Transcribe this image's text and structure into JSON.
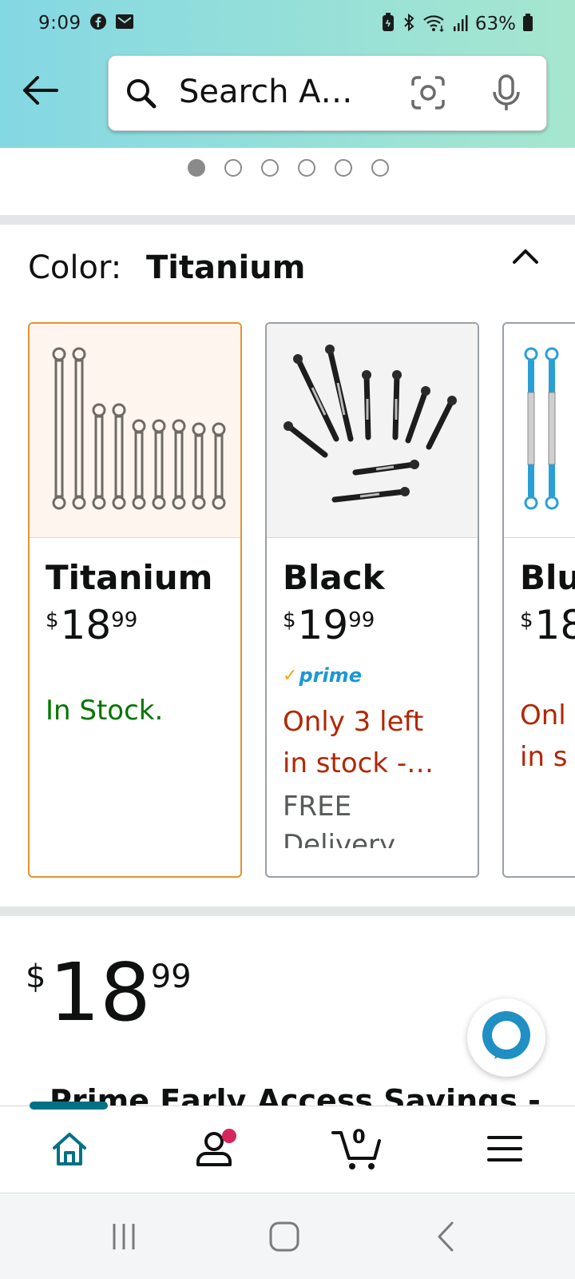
{
  "status_bar": {
    "time": "9:09",
    "battery": "63%",
    "icons": [
      "facebook-icon",
      "gmail-icon",
      "battery-saver-icon",
      "bluetooth-icon",
      "wifi-icon",
      "signal-icon",
      "battery-icon"
    ]
  },
  "search": {
    "text": "Search A…",
    "icons": [
      "back-arrow-icon",
      "search-icon",
      "camera-lens-icon",
      "microphone-icon"
    ]
  },
  "carousel": {
    "total": 6,
    "active": 1
  },
  "color_selector": {
    "label": "Color:",
    "selected": "Titanium",
    "options": [
      {
        "name": "Titanium",
        "price": {
          "symbol": "$",
          "whole": "18",
          "fraction": "99"
        },
        "availability": "In Stock.",
        "availability_color": "#007600",
        "selected": true
      },
      {
        "name": "Black",
        "price": {
          "symbol": "$",
          "whole": "19",
          "fraction": "99"
        },
        "prime_check": "✓",
        "prime": "prime",
        "availability_lines": [
          "Only 3 left",
          "in stock -…"
        ],
        "availability_color": "#B12704",
        "shipping_lines": [
          "FREE",
          "Delivery"
        ],
        "selected": false
      },
      {
        "name": "Blu",
        "price": {
          "symbol": "$",
          "whole": "18",
          "fraction": ""
        },
        "availability_lines": [
          "Onl",
          "in s"
        ],
        "availability_color": "#B12704",
        "selected": false
      }
    ]
  },
  "price": {
    "symbol": "$",
    "whole": "18",
    "fraction": "99"
  },
  "deal_text": "Prime Early Access Savings -",
  "bottom_nav": {
    "items": [
      "home-icon",
      "account-icon",
      "cart-icon",
      "menu-icon"
    ],
    "cart_count": "0",
    "active": "home",
    "accent": "#007185"
  },
  "colors": {
    "selected_border": "#E4932F",
    "in_stock": "#007600",
    "low_stock": "#B12704",
    "prime": "#1A98D5"
  }
}
